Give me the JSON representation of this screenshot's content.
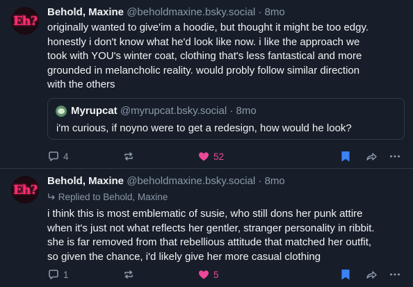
{
  "posts": [
    {
      "avatar_text": "Eh?",
      "author": "Behold, Maxine",
      "handle": "@beholdmaxine.bsky.social",
      "separator": "·",
      "time": "8mo",
      "lines": [
        "originally wanted to give'im a hoodie, but thought it might be too edgy.",
        "honestly i don't know what he'd look like now. i like the approach we",
        "took with YOU's winter coat, clothing that's less fantastical and more",
        "grounded in melancholic reality. would probly follow similar direction",
        "with the others"
      ],
      "quote": {
        "author": "Myrupcat",
        "handle": "@myrupcat.bsky.social",
        "separator": "·",
        "time": "8mo",
        "text": "i'm curious, if noyno were to get a redesign, how would he look?"
      },
      "replies": "4",
      "likes": "52"
    },
    {
      "avatar_text": "Eh?",
      "author": "Behold, Maxine",
      "handle": "@beholdmaxine.bsky.social",
      "separator": "·",
      "time": "8mo",
      "replied_to": "Replied to Behold, Maxine",
      "lines": [
        "i think this is most emblematic of susie, who still dons her punk attire",
        "when it's just not what reflects her gentler, stranger personality in ribbit.",
        "she is far removed from that rebellious attitude that matched her outfit,",
        "so given the chance, i'd likely give her more casual clothing"
      ],
      "replies": "1",
      "likes": "5"
    }
  ],
  "icons": {
    "reply": "speech-bubble-icon",
    "repost": "repost-arrows-icon",
    "like": "heart-icon",
    "bookmark": "bookmark-icon",
    "share": "share-arrow-icon",
    "more": "ellipsis-icon",
    "replied": "reply-arrow-icon"
  },
  "colors": {
    "background": "#171e29",
    "muted": "#8b98a9",
    "like": "#ec4899",
    "bookmark": "#3b82f6",
    "avatar_accent": "#ff2d6f"
  }
}
